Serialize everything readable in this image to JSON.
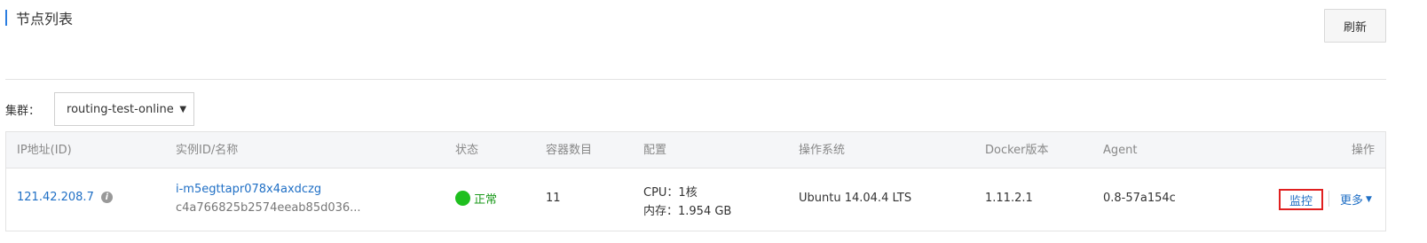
{
  "header": {
    "title": "节点列表",
    "refresh_label": "刷新"
  },
  "cluster": {
    "label": "集群：",
    "selected": "routing-test-online"
  },
  "table": {
    "columns": [
      "IP地址(ID)",
      "实例ID/名称",
      "状态",
      "容器数目",
      "配置",
      "操作系统",
      "Docker版本",
      "Agent",
      "操作"
    ],
    "rows": [
      {
        "ip": "121.42.208.7",
        "instance_id": "i-m5egttapr078x4axdczg",
        "instance_name": "c4a766825b2574eeab85d036...",
        "status": "正常",
        "container_count": "11",
        "config_cpu": "CPU：1核",
        "config_mem": "内存：1.954 GB",
        "os": "Ubuntu 14.04.4 LTS",
        "docker_version": "1.11.2.1",
        "agent": "0.8-57a154c",
        "action_monitor": "监控",
        "action_more": "更多"
      }
    ]
  },
  "colors": {
    "accent": "#2b7de0",
    "link": "#1f6fc5",
    "status_ok": "#1fbf1f",
    "highlight_border": "#e02020"
  },
  "icons": {
    "info": "info-icon",
    "caret": "chevron-down-icon"
  }
}
